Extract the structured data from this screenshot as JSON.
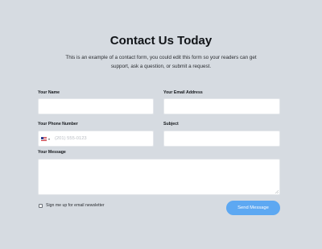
{
  "form": {
    "title": "Contact Us Today",
    "intro": "This is an example of a contact form, you could edit this form so your readers can get support, ask a question, or submit a request.",
    "fields": {
      "name": {
        "label": "Your Name",
        "value": ""
      },
      "email": {
        "label": "Your Email Address",
        "value": ""
      },
      "phone": {
        "label": "Your Phone Number",
        "value": "",
        "placeholder": "(201) 555-0123",
        "country_flag": "us-flag-icon"
      },
      "subject": {
        "label": "Subject",
        "value": ""
      },
      "message": {
        "label": "Your Message",
        "value": ""
      }
    },
    "newsletter": {
      "label": "Sign me up for email newsletter",
      "checked": false
    },
    "submit_label": "Send Message"
  },
  "colors": {
    "background": "#d6dbe1",
    "button": "#5da8f2",
    "field": "#ffffff"
  }
}
